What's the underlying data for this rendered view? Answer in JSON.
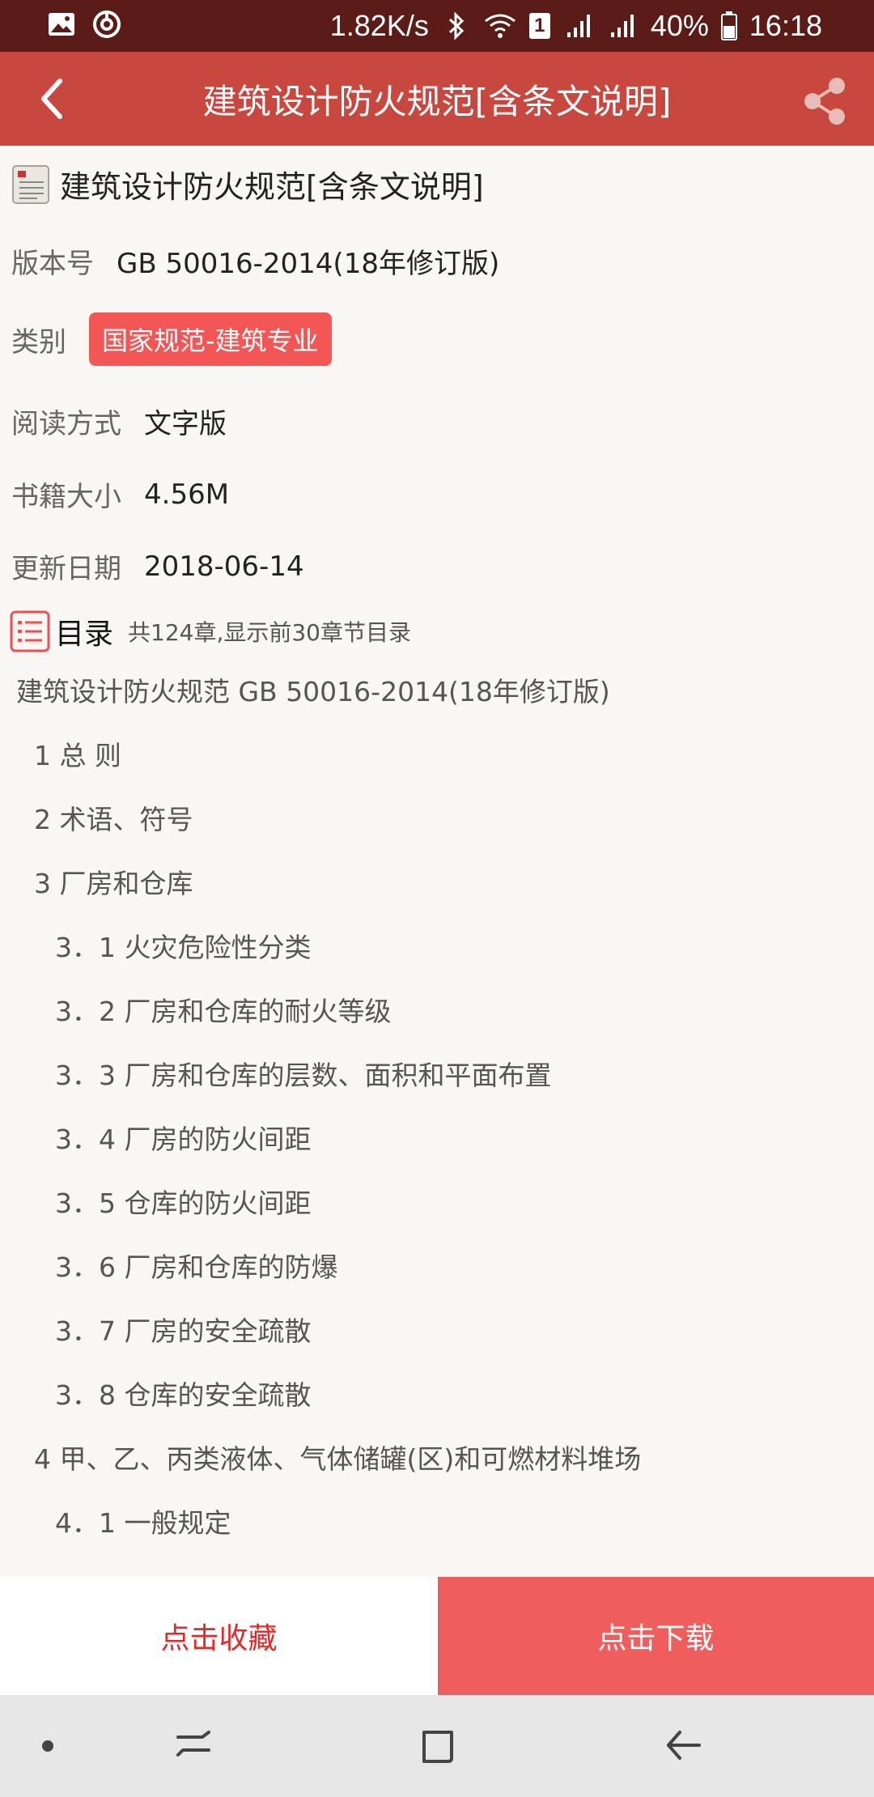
{
  "status_bar": {
    "net_speed": "1.82K/s",
    "battery": "40%",
    "time": "16:18",
    "sim_badge": "1",
    "icons": [
      "gallery-icon",
      "sync-icon",
      "bluetooth-icon",
      "wifi-icon",
      "sim-icon",
      "signal-icon",
      "signal-icon",
      "battery-icon"
    ]
  },
  "app_bar": {
    "title": "建筑设计防火规范[含条文说明]",
    "back_icon": "chevron-left-icon",
    "share_icon": "share-icon"
  },
  "book": {
    "title": "建筑设计防火规范[含条文说明]",
    "version_label": "版本号",
    "version_value": "GB 50016-2014(18年修订版)",
    "category_label": "类别",
    "category_value": "国家规范-建筑专业",
    "read_mode_label": "阅读方式",
    "read_mode_value": "文字版",
    "size_label": "书籍大小",
    "size_value": "4.56M",
    "update_label": "更新日期",
    "update_value": "2018-06-14"
  },
  "toc": {
    "title": "目录",
    "note": "共124章,显示前30章节目录",
    "items": [
      {
        "text": "建筑设计防火规范 GB 50016-2014(18年修订版)",
        "level": 0
      },
      {
        "text": "1 总 则",
        "level": 1
      },
      {
        "text": "2 术语、符号",
        "level": 1
      },
      {
        "text": "3 厂房和仓库",
        "level": 1
      },
      {
        "text": "3．1 火灾危险性分类",
        "level": 2
      },
      {
        "text": "3．2 厂房和仓库的耐火等级",
        "level": 2
      },
      {
        "text": "3．3 厂房和仓库的层数、面积和平面布置",
        "level": 2
      },
      {
        "text": "3．4 厂房的防火间距",
        "level": 2
      },
      {
        "text": "3．5 仓库的防火间距",
        "level": 2
      },
      {
        "text": "3．6 厂房和仓库的防爆",
        "level": 2
      },
      {
        "text": "3．7 厂房的安全疏散",
        "level": 2
      },
      {
        "text": "3．8 仓库的安全疏散",
        "level": 2
      },
      {
        "text": "4 甲、乙、丙类液体、气体储罐(区)和可燃材料堆场",
        "level": 1
      },
      {
        "text": "4．1 一般规定",
        "level": 2
      }
    ]
  },
  "actions": {
    "favorite_label": "点击收藏",
    "download_label": "点击下载"
  },
  "colors": {
    "status_bar": "#5b1c17",
    "app_bar": "#c8473e",
    "accent": "#f45656",
    "download_button": "#ef5d5d",
    "favorite_text": "#e02a2a"
  }
}
